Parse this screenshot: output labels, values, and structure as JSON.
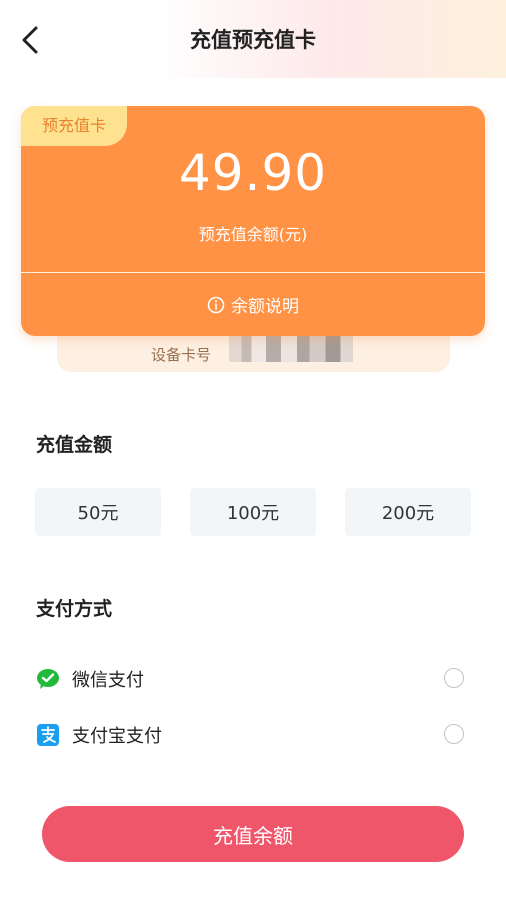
{
  "header": {
    "title": "充值预充值卡"
  },
  "card": {
    "tag": "预充值卡",
    "amount": "49.90",
    "amount_label": "预充值余额(元)",
    "info_label": "余额说明",
    "device_label": "设备卡号"
  },
  "recharge": {
    "title": "充值金额",
    "options": [
      "50元",
      "100元",
      "200元"
    ]
  },
  "payment": {
    "title": "支付方式",
    "methods": [
      {
        "label": "微信支付",
        "icon": "wechat-pay-icon"
      },
      {
        "label": "支付宝支付",
        "icon": "alipay-icon"
      }
    ]
  },
  "submit": {
    "label": "充值余额"
  },
  "colors": {
    "card": "#ff9245",
    "tag": "#ffe28f",
    "submit": "#f0566a",
    "wechat": "#22b93d",
    "alipay": "#1a9ff0"
  }
}
